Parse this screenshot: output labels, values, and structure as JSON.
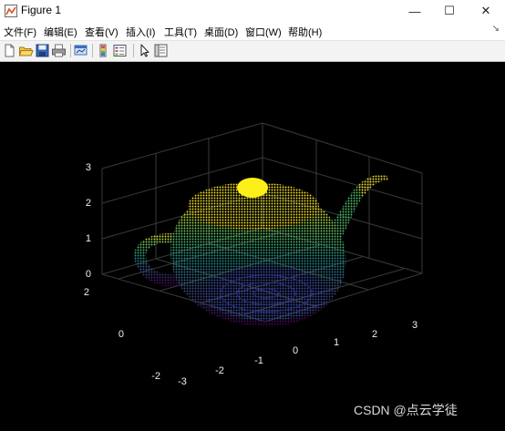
{
  "window": {
    "title": "Figure 1",
    "minimize_glyph": "—",
    "maximize_glyph": "☐",
    "close_glyph": "✕"
  },
  "menu": {
    "items": [
      {
        "label": "文件(F)"
      },
      {
        "label": "编辑(E)"
      },
      {
        "label": "查看(V)"
      },
      {
        "label": "插入(I)"
      },
      {
        "label": "工具(T)"
      },
      {
        "label": "桌面(D)"
      },
      {
        "label": "窗口(W)"
      },
      {
        "label": "帮助(H)"
      }
    ],
    "close_glyph": "↘"
  },
  "toolbar": {
    "icons": [
      "new-figure-icon",
      "open-file-icon",
      "save-icon",
      "print-icon",
      "link-plot-icon",
      "insert-colorbar-icon",
      "insert-legend-icon",
      "edit-plot-arrow-icon",
      "property-inspector-icon"
    ]
  },
  "plot": {
    "background": "#000000",
    "colormap": [
      "#440154",
      "#3b528b",
      "#21918c",
      "#5ec962",
      "#fde725"
    ],
    "z_ticks": [
      "0",
      "1",
      "2",
      "3"
    ],
    "y_ticks": [
      "-2",
      "0",
      "2"
    ],
    "x_ticks": [
      "-3",
      "-2",
      "-1",
      "0",
      "1",
      "2",
      "3"
    ],
    "grid": true
  },
  "watermark": "CSDN @点云学徒"
}
